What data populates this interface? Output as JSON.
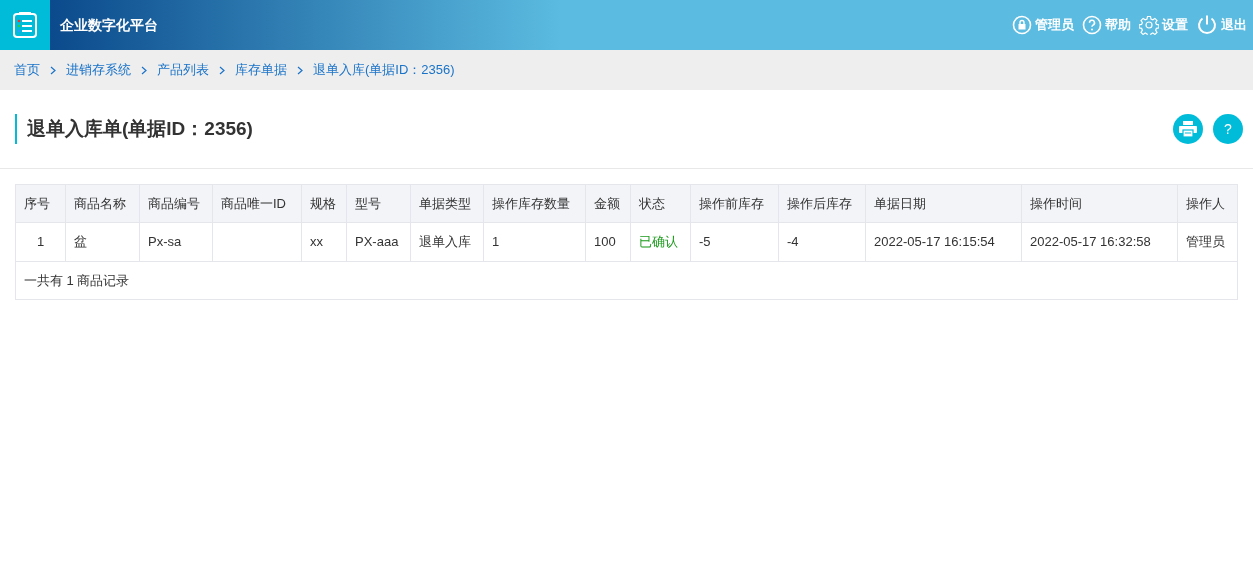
{
  "app_title": "企业数字化平台",
  "top_menu": [
    {
      "kind": "lock",
      "label": "管理员"
    },
    {
      "kind": "help",
      "label": "帮助"
    },
    {
      "kind": "gear",
      "label": "设置"
    },
    {
      "kind": "power",
      "label": "退出"
    }
  ],
  "breadcrumb": [
    "首页",
    "进销存系统",
    "产品列表",
    "库存单据",
    "退单入库(单据ID：2356)"
  ],
  "page_title": "退单入库单(单据ID：2356)",
  "actions": [
    {
      "kind": "print"
    },
    {
      "kind": "help",
      "label": "?"
    }
  ],
  "table": {
    "columns": [
      {
        "label": "序号",
        "kind": "center"
      },
      {
        "label": "商品名称",
        "kind": "text"
      },
      {
        "label": "商品编号",
        "kind": "text"
      },
      {
        "label": "商品唯一ID",
        "kind": "text"
      },
      {
        "label": "规格",
        "kind": "text"
      },
      {
        "label": "型号",
        "kind": "text"
      },
      {
        "label": "单据类型",
        "kind": "text"
      },
      {
        "label": "操作库存数量",
        "kind": "text"
      },
      {
        "label": "金额",
        "kind": "text"
      },
      {
        "label": "状态",
        "kind": "status"
      },
      {
        "label": "操作前库存",
        "kind": "text"
      },
      {
        "label": "操作后库存",
        "kind": "text"
      },
      {
        "label": "单据日期",
        "kind": "text"
      },
      {
        "label": "操作时间",
        "kind": "text"
      },
      {
        "label": "操作人",
        "kind": "text"
      }
    ],
    "rows": [
      [
        "1",
        "盆",
        "Px-sa",
        "",
        "xx",
        "PX-aaa",
        "退单入库",
        "1",
        "100",
        "已确认",
        "-5",
        "-4",
        "2022-05-17 16:15:54",
        "2022-05-17 16:32:58",
        "管理员"
      ]
    ],
    "footer": "一共有 1 商品记录"
  }
}
